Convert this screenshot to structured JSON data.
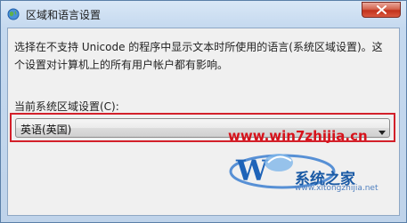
{
  "window": {
    "title": "区域和语言设置",
    "icon": "globe-icon",
    "close_icon": "close-icon"
  },
  "dialog": {
    "description": "选择在不支持 Unicode 的程序中显示文本时所使用的语言(系统区域设置)。这个设置对计算机上的所有用户帐户都有影响。",
    "field_label": "当前系统区域设置(C):",
    "selected_locale": "英语(英国)",
    "highlight_color": "#d3202a"
  },
  "watermark": {
    "url": "www.win7zhijia.cn",
    "logo_text": "系统之家",
    "logo_letter": "W",
    "logo_subtext": "www.xitongzhijia.net"
  }
}
